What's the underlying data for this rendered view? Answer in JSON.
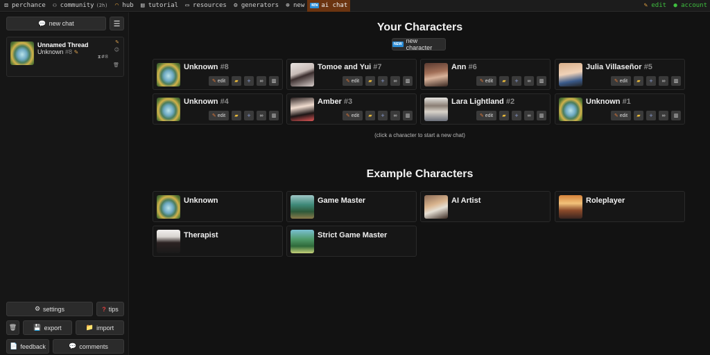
{
  "topnav": {
    "items": [
      {
        "label": "perchance",
        "icon": "dice-icon"
      },
      {
        "label": "community",
        "sub": "(2h)",
        "icon": "users-icon"
      },
      {
        "label": "hub",
        "icon": "rainbow-icon"
      },
      {
        "label": "tutorial",
        "icon": "book-icon"
      },
      {
        "label": "resources",
        "icon": "folder-icon"
      },
      {
        "label": "generators",
        "icon": "gear-icon"
      },
      {
        "label": "new",
        "icon": "globe-icon"
      },
      {
        "label": "ai chat",
        "badge": "NEW",
        "icon": "chat-icon"
      }
    ],
    "right": [
      {
        "label": "edit",
        "icon": "pencil-icon"
      },
      {
        "label": "account",
        "icon": "user-icon"
      }
    ],
    "active_color": "#6b3410",
    "right_color": "#3fbf3f"
  },
  "sidebar": {
    "new_chat": "new chat",
    "thread": {
      "title": "Unnamed Thread",
      "character": "Unknown",
      "num": "#8",
      "count": "#8"
    },
    "settings": "settings",
    "tips": "tips",
    "export": "export",
    "import": "import",
    "feedback": "feedback",
    "comments": "comments"
  },
  "main": {
    "your_title": "Your Characters",
    "new_character": "new character",
    "hint": "(click a character to start a new chat)",
    "example_title": "Example Characters",
    "edit_label": "edit",
    "your": [
      {
        "name": "Unknown",
        "num": "#8",
        "avatar": "egg"
      },
      {
        "name": "Tomoe and Yui",
        "num": "#7",
        "avatar": "girl1"
      },
      {
        "name": "Ann",
        "num": "#6",
        "avatar": "girl2"
      },
      {
        "name": "Julia Villaseñor",
        "num": "#5",
        "avatar": "girl3"
      },
      {
        "name": "Unknown",
        "num": "#4",
        "avatar": "egg"
      },
      {
        "name": "Amber",
        "num": "#3",
        "avatar": "girl4"
      },
      {
        "name": "Lara Lightland",
        "num": "#2",
        "avatar": "girl5"
      },
      {
        "name": "Unknown",
        "num": "#1",
        "avatar": "egg"
      }
    ],
    "examples": [
      {
        "name": "Unknown",
        "avatar": "egg"
      },
      {
        "name": "Game Master",
        "avatar": "gm"
      },
      {
        "name": "AI Artist",
        "avatar": "artist"
      },
      {
        "name": "Roleplayer",
        "avatar": "rp"
      },
      {
        "name": "Therapist",
        "avatar": "ther"
      },
      {
        "name": "Strict Game Master",
        "avatar": "sgm"
      }
    ]
  }
}
